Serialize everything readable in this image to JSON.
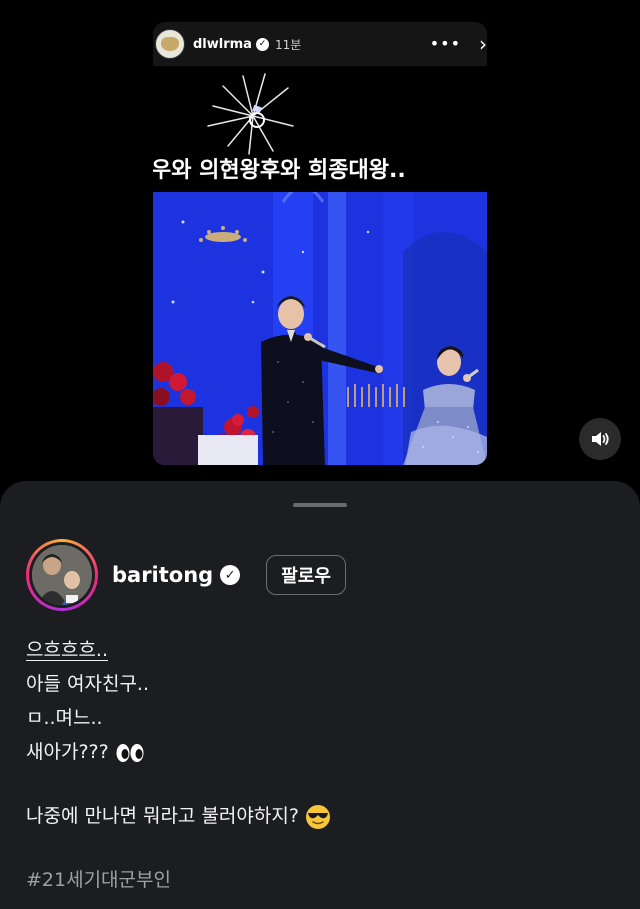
{
  "story": {
    "username": "dlwlrma",
    "time": "11분",
    "more_label": "•••",
    "close_label": "›",
    "caption": "우와 의현왕후와 희종대왕..",
    "sticker_icon": "ring-icon"
  },
  "sound_icon": "speaker-icon",
  "post": {
    "username": "baritong",
    "follow_label": "팔로우",
    "lines": [
      "으흐흐흐..",
      "아들 여자친구..",
      "ㅁ..며느..",
      "새아가???"
    ],
    "line5": "나중에 만나면 뭐라고 불러야하지?",
    "hashtag": "#21세기대군부인"
  },
  "colors": {
    "sheet_bg": "#1c1d21",
    "stage_blue": "#1f3af0",
    "hashtag": "#9fa0a5"
  }
}
